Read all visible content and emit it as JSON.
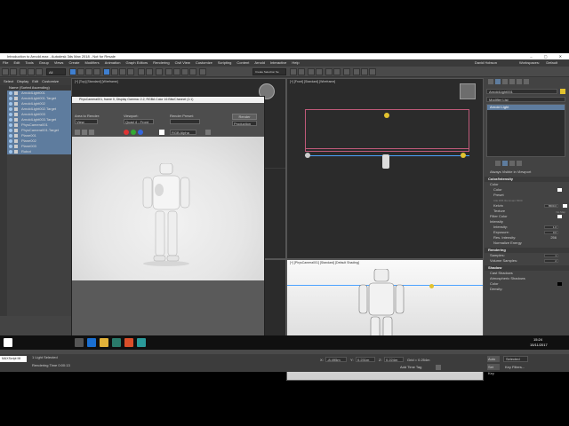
{
  "window": {
    "title": "Introduction to Arnold.max - Autodesk 3ds Max 2018 - Not for Resale"
  },
  "menu": [
    "File",
    "Edit",
    "Tools",
    "Group",
    "Views",
    "Create",
    "Modifiers",
    "Animation",
    "Graph Editors",
    "Rendering",
    "Civil View",
    "Customize",
    "Scripting",
    "Content",
    "Arnold",
    "Interactive",
    "Help"
  ],
  "account": {
    "user": "David Hobson",
    "workspace_label": "Workspaces:",
    "workspace": "Default"
  },
  "toolbar": {
    "selection_filter": "All",
    "create_selection_set": "Create Selection Se"
  },
  "scene_explorer": {
    "tabs": [
      "Select",
      "Display",
      "Edit",
      "Customize"
    ],
    "header": "Name (Sorted Ascending)",
    "items": [
      {
        "label": "ArnoldLight001",
        "selected": true
      },
      {
        "label": "ArnoldLight001.Target",
        "selected": true
      },
      {
        "label": "ArnoldLight002",
        "selected": true
      },
      {
        "label": "ArnoldLight002.Target",
        "selected": true
      },
      {
        "label": "ArnoldLight003",
        "selected": true
      },
      {
        "label": "ArnoldLight003.Target",
        "selected": true
      },
      {
        "label": "PhysCamera001",
        "selected": true
      },
      {
        "label": "PhysCamera001.Target",
        "selected": true
      },
      {
        "label": "Plane001",
        "selected": true
      },
      {
        "label": "Plane002",
        "selected": true
      },
      {
        "label": "Plane003",
        "selected": true
      },
      {
        "label": "Robot",
        "selected": true
      }
    ]
  },
  "viewports": {
    "top": "[+] [Top] [Standard] [Wireframe]",
    "front": "[+] [Front] [Standard] [Wireframe]",
    "camera": "[+] [PhysCamera001] [Standard] [Default Shading]"
  },
  "render_window": {
    "title": "PhysCamera001, frame 0, Display Gamma: 2.2, RGBA Color 16 Bits/Channel (1:1)",
    "area_label": "Area to Render:",
    "area_value": "View",
    "viewport_label": "Viewport:",
    "viewport_value": "Quad 4 - Front",
    "preset_label": "Render Preset:",
    "preset_value": "",
    "render_button": "Render",
    "production": "Production",
    "channel": "RGB Alpha"
  },
  "command_panel": {
    "object_name": "ArnoldLight001",
    "modifier_list": "Modifier List",
    "stack_item": "Arnold Light",
    "always_visible": "Always Visible in Viewport",
    "color_header": "Color/Intensity",
    "color_label": "Color",
    "color_opt": "Color",
    "preset_opt": "Preset",
    "preset_value": "CIE D65 Illuminant 6500",
    "kelvin_opt": "Kelvin",
    "kelvin_value": "6500.0",
    "texture_opt": "Texture",
    "texture_value": "No Map",
    "filter_color": "Filter Color",
    "intensity_header": "Intensity",
    "intensity_label": "Intensity:",
    "intensity_value": "1.0",
    "exposure_label": "Exposure:",
    "exposure_value": "0.0",
    "res_intensity_label": "Res. Intensity:",
    "res_intensity_value": "256",
    "normalize": "Normalize Energy",
    "rendering_header": "Rendering",
    "samples_label": "Samples:",
    "samples_value": "1",
    "volume_samples_label": "Volume Samples:",
    "volume_samples_value": "2",
    "shadow_header": "Shadow",
    "cast_shadows": "Cast Shadows",
    "atmospheric_shadows": "Atmospheric Shadows",
    "shadow_color": "Color",
    "density_label": "Density:"
  },
  "timeline": {
    "frame": "0 / 100",
    "ticks": [
      "0",
      "5",
      "10",
      "15",
      "20",
      "25",
      "30",
      "35",
      "40",
      "45",
      "50",
      "55",
      "60",
      "65",
      "70",
      "75",
      "80",
      "85",
      "90",
      "95",
      "100"
    ]
  },
  "status": {
    "selected": "1 Light Selected",
    "render_time": "Rendering Time 0:00:13",
    "maxscript": "MAXScript Mi",
    "default": "Default",
    "x_label": "X:",
    "x": "-8.495m",
    "y_label": "Y:",
    "y": "0.231m",
    "z_label": "Z:",
    "z": "0.224m",
    "grid": "Grid = 0.254m",
    "add_time_tag": "Add Time Tag",
    "autokey": "Auto Key",
    "setkey": "Set Key",
    "selected_filter": "Selected",
    "key_filters": "Key Filters..."
  },
  "taskbar": {
    "time": "15:24",
    "date": "15/11/2017"
  }
}
